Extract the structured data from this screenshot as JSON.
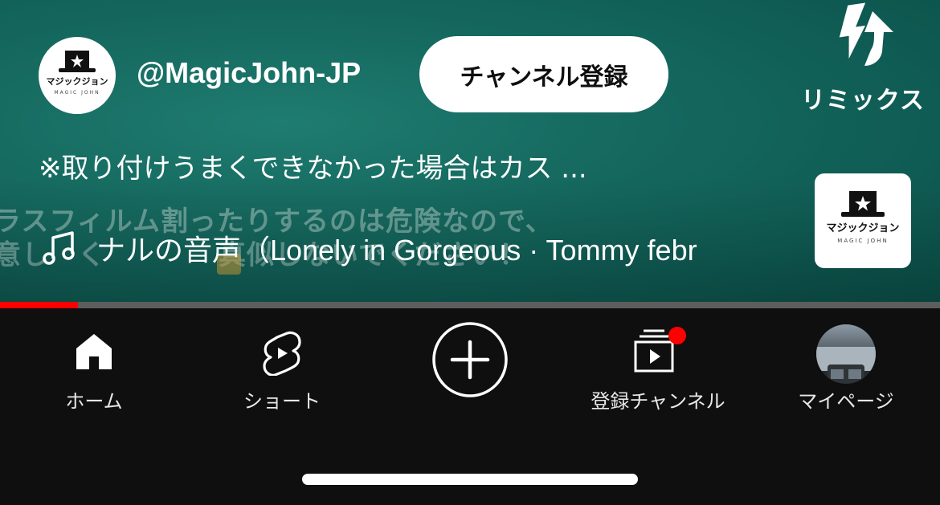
{
  "video": {
    "channel_handle": "@MagicJohn-JP",
    "subscribe_label": "チャンネル登録",
    "remix_label": "リミックス",
    "title": "※取り付けうまくできなかった場合はカス ...",
    "burned_caption_line1": "ラスフィルム割ったりするのは危険なので、",
    "burned_caption_line2": "意し　く　　　　真似しないでください！",
    "music_text": "ナルの音声（Lonely in Gorgeous · Tommy febr",
    "channel_logo": {
      "name": "マジックジョン",
      "sub": "MAGIC JOHN"
    },
    "progress_fraction": 0.083
  },
  "nav": {
    "items": [
      {
        "label": "ホーム",
        "icon": "home-icon"
      },
      {
        "label": "ショート",
        "icon": "shorts-icon"
      },
      {
        "label": "",
        "icon": "create-plus-icon"
      },
      {
        "label": "登録チャンネル",
        "icon": "subscriptions-icon"
      },
      {
        "label": "マイページ",
        "icon": "profile-avatar"
      }
    ]
  },
  "colors": {
    "accent_red": "#ff0000",
    "nav_background": "#0f0f0f",
    "video_teal": "#166a60"
  }
}
